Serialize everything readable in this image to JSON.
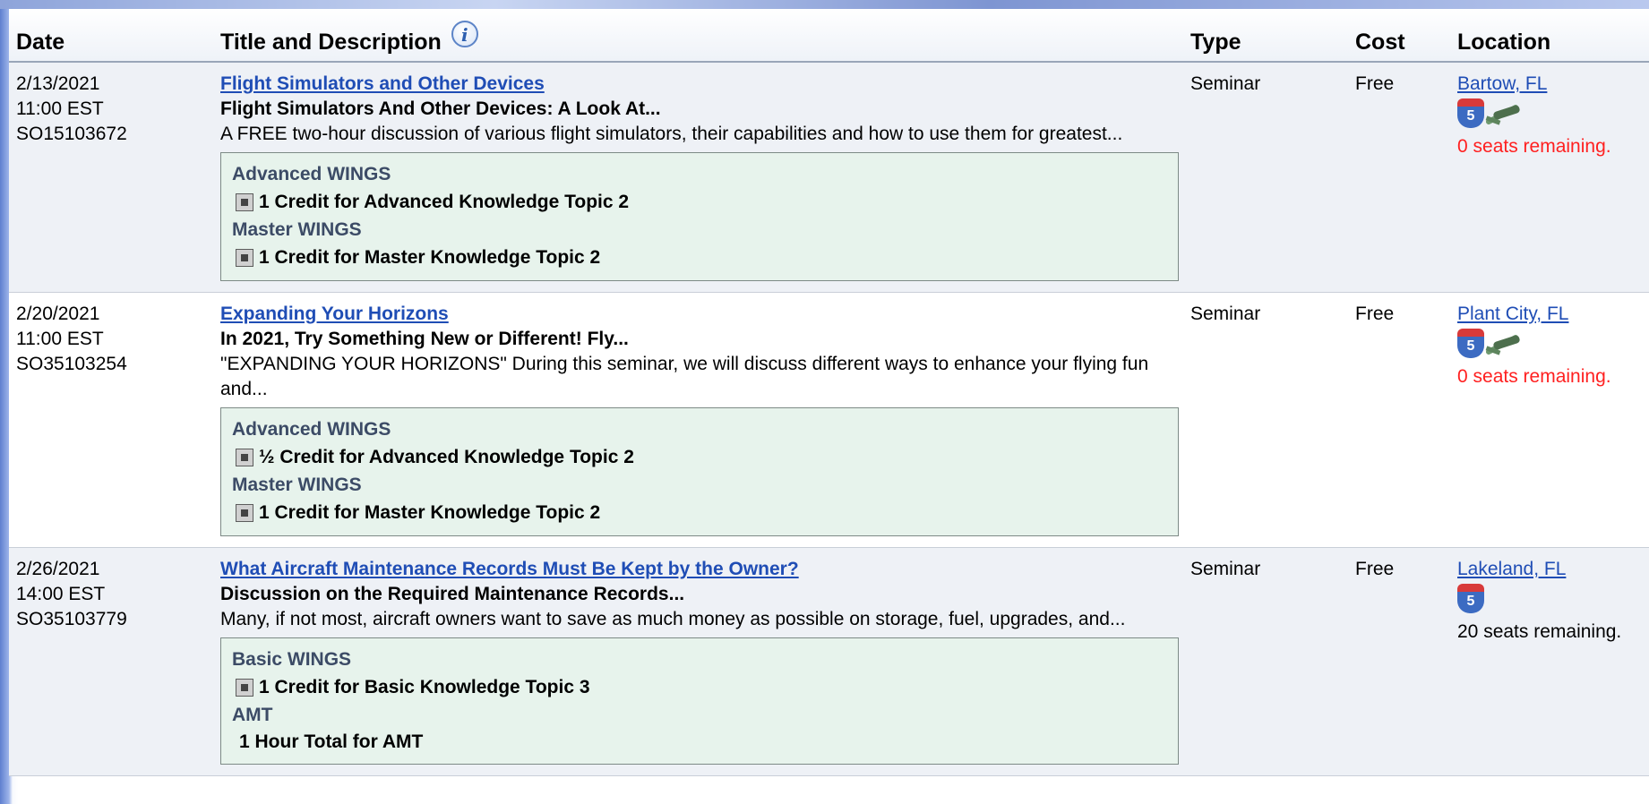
{
  "columns": {
    "date": "Date",
    "title": "Title and Description",
    "type": "Type",
    "cost": "Cost",
    "location": "Location"
  },
  "events": [
    {
      "date": "2/13/2021",
      "time": "11:00 EST",
      "code": "SO15103672",
      "title": "Flight Simulators and Other Devices",
      "subtitle": "Flight Simulators And Other Devices: A Look At...",
      "description": "A FREE two-hour discussion of various flight simulators, their capabilities and how to use them for greatest...",
      "credits": [
        {
          "program": "Advanced WINGS",
          "credit": "1 Credit for Advanced Knowledge Topic 2"
        },
        {
          "program": "Master WINGS",
          "credit": "1 Credit for Master Knowledge Topic 2"
        }
      ],
      "type": "Seminar",
      "cost": "Free",
      "location": "Bartow, FL",
      "icons": [
        "interstate-shield-icon",
        "airplane-icon"
      ],
      "seats": "0 seats remaining."
    },
    {
      "date": "2/20/2021",
      "time": "11:00 EST",
      "code": "SO35103254",
      "title": "Expanding Your Horizons",
      "subtitle": "In 2021, Try Something New or Different! Fly...",
      "description": "\"EXPANDING YOUR HORIZONS\" During this seminar, we will discuss different ways to enhance your flying fun and...",
      "credits": [
        {
          "program": "Advanced WINGS",
          "credit": "½ Credit for Advanced Knowledge Topic 2"
        },
        {
          "program": "Master WINGS",
          "credit": "1 Credit for Master Knowledge Topic 2"
        }
      ],
      "type": "Seminar",
      "cost": "Free",
      "location": "Plant City, FL",
      "icons": [
        "interstate-shield-icon",
        "airplane-icon"
      ],
      "seats": "0 seats remaining."
    },
    {
      "date": "2/26/2021",
      "time": "14:00 EST",
      "code": "SO35103779",
      "title": "What Aircraft Maintenance Records Must Be Kept by the Owner?",
      "subtitle": "Discussion on the Required Maintenance Records...",
      "description": "Many, if not most, aircraft owners want to save as much money as possible on storage, fuel, upgrades, and...",
      "credits": [
        {
          "program": "Basic WINGS",
          "credit": "1 Credit for Basic Knowledge Topic 3"
        }
      ],
      "amt": {
        "program": "AMT",
        "credit": "1 Hour Total for AMT"
      },
      "type": "Seminar",
      "cost": "Free",
      "location": "Lakeland, FL",
      "icons": [
        "interstate-shield-icon"
      ],
      "seats": "20 seats remaining."
    }
  ],
  "colors": {
    "link": "#1f4db5",
    "seats_full": "#ff2020",
    "credit_box_bg": "#e7f3ec"
  }
}
